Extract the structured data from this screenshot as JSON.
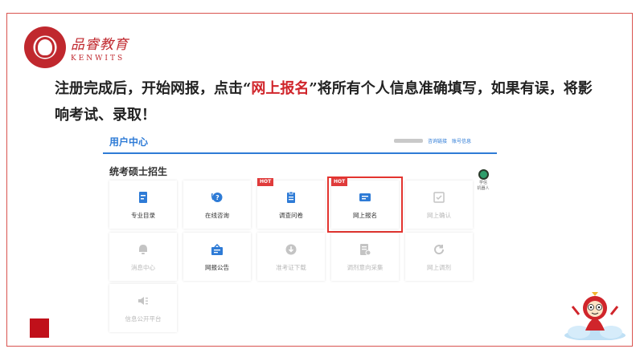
{
  "brand": {
    "name_cn": "品睿教育",
    "name_en": "KENWITS"
  },
  "instruction": {
    "prefix": "注册完成后，开始网报，点击“",
    "highlight": "网上报名",
    "suffix": "”将所有个人信息准确填写，如果有误，将影响考试、录取！"
  },
  "user_center": {
    "title": "用户中心",
    "links": [
      "咨询链接",
      "账号信息"
    ],
    "section_title": "统考硕士招生"
  },
  "cards": [
    {
      "label": "专业目录",
      "icon": "document-icon",
      "disabled": false,
      "badge": ""
    },
    {
      "label": "在线咨询",
      "icon": "chat-help-icon",
      "disabled": false,
      "badge": ""
    },
    {
      "label": "调查问卷",
      "icon": "survey-icon",
      "disabled": false,
      "badge": "HOT"
    },
    {
      "label": "网上报名",
      "icon": "registration-card-icon",
      "disabled": false,
      "badge": "HOT",
      "selected": true
    },
    {
      "label": "网上确认",
      "icon": "checklist-icon",
      "disabled": true,
      "badge": ""
    },
    {
      "label": "消息中心",
      "icon": "bell-icon",
      "disabled": true,
      "badge": ""
    },
    {
      "label": "网报公告",
      "icon": "announcement-icon",
      "disabled": false,
      "badge": ""
    },
    {
      "label": "准考证下载",
      "icon": "download-icon",
      "disabled": true,
      "badge": ""
    },
    {
      "label": "调剂意向采集",
      "icon": "collect-icon",
      "disabled": true,
      "badge": ""
    },
    {
      "label": "网上调剂",
      "icon": "refresh-icon",
      "disabled": true,
      "badge": ""
    },
    {
      "label": "信息公开平台",
      "icon": "speaker-icon",
      "disabled": true,
      "badge": ""
    }
  ],
  "robot": {
    "line1": "学信",
    "line2": "机器人"
  },
  "colors": {
    "brand_red": "#c0282e",
    "accent_blue": "#2e7bd6",
    "highlight_red": "#e3342f"
  }
}
